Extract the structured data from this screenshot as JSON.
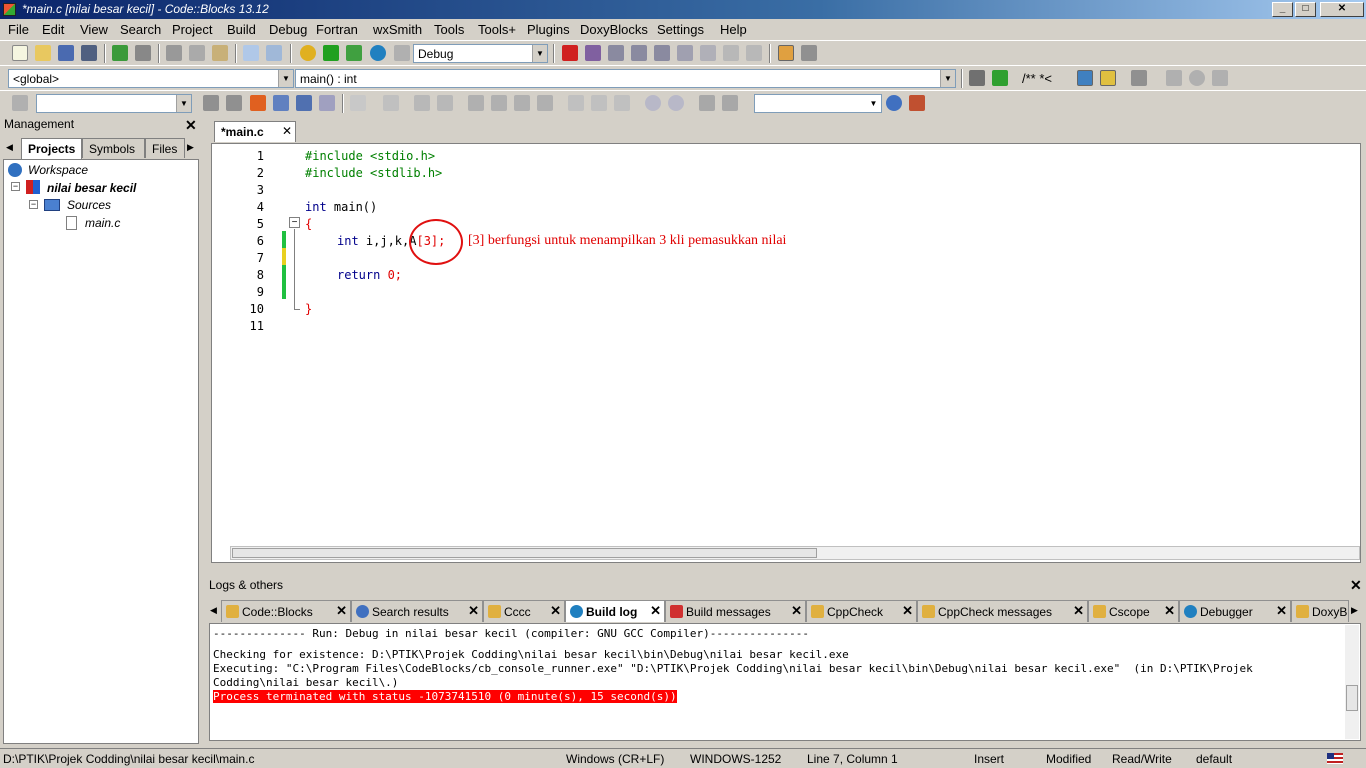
{
  "window": {
    "title": "*main.c [nilai besar kecil] - Code::Blocks 13.12"
  },
  "menu": [
    "File",
    "Edit",
    "View",
    "Search",
    "Project",
    "Build",
    "Debug",
    "Fortran",
    "wxSmith",
    "Tools",
    "Tools+",
    "Plugins",
    "DoxyBlocks",
    "Settings",
    "Help"
  ],
  "toolbar": {
    "build_target": "Debug",
    "scope": "<global>",
    "function": "main() : int",
    "doxy_comment": "/** *<"
  },
  "management": {
    "title": "Management",
    "tabs": [
      "Projects",
      "Symbols",
      "Files"
    ],
    "tree": {
      "workspace": "Workspace",
      "project": "nilai besar kecil",
      "folder": "Sources",
      "file": "main.c"
    }
  },
  "editor": {
    "tab": "*main.c",
    "lines": [
      "1",
      "2",
      "3",
      "4",
      "5",
      "6",
      "7",
      "8",
      "9",
      "10",
      "11"
    ],
    "code": {
      "l1": "#include <stdio.h>",
      "l2": "#include <stdlib.h>",
      "l4_kw": "int",
      "l4_rest": " main()",
      "l5": "{",
      "l6_kw": "int",
      "l6_rest": " i,j,k,A",
      "l6_arr": "[3];",
      "l8_kw": "return",
      "l8_num": " 0;",
      "l10": "}"
    },
    "annotation": "[3] berfungsi untuk menampilkan 3 kli pemasukkan nilai"
  },
  "logs": {
    "title": "Logs & others",
    "tabs": [
      "Code::Blocks",
      "Search results",
      "Cccc",
      "Build log",
      "Build messages",
      "CppCheck",
      "CppCheck messages",
      "Cscope",
      "Debugger",
      "DoxyB"
    ],
    "lines": [
      "-------------- Run: Debug in nilai besar kecil (compiler: GNU GCC Compiler)---------------",
      "Checking for existence: D:\\PTIK\\Projek Codding\\nilai besar kecil\\bin\\Debug\\nilai besar kecil.exe",
      "Executing: \"C:\\Program Files\\CodeBlocks/cb_console_runner.exe\" \"D:\\PTIK\\Projek Codding\\nilai besar kecil\\bin\\Debug\\nilai besar kecil.exe\"  (in D:\\PTIK\\Projek",
      "Codding\\nilai besar kecil\\.)",
      "Process terminated with status -1073741510 (0 minute(s), 15 second(s))"
    ]
  },
  "status": {
    "path": "D:\\PTIK\\Projek Codding\\nilai besar kecil\\main.c",
    "eol": "Windows (CR+LF)",
    "encoding": "WINDOWS-1252",
    "position": "Line 7, Column 1",
    "mode": "Insert",
    "modified": "Modified",
    "access": "Read/Write",
    "lang": "default"
  }
}
